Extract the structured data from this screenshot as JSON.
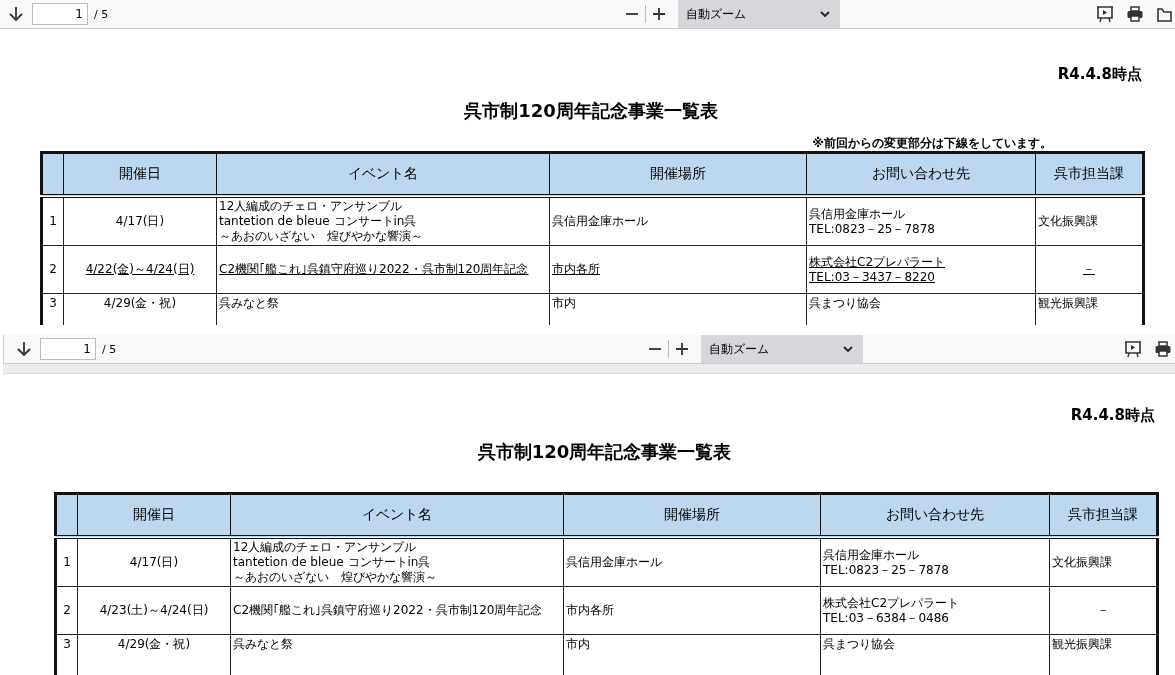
{
  "viewers": [
    {
      "toolbar": {
        "page": "1",
        "page_count": "/ 5",
        "zoom": "自動ズーム",
        "right_tools": [
          {
            "kind": "presentation"
          },
          {
            "kind": "print"
          },
          {
            "kind": "open"
          }
        ]
      },
      "document": {
        "date_label": "R4.4.8時点",
        "title": "呉市制120周年記念事業一覧表",
        "note": "※前回からの変更部分は下線をしています。",
        "table": {
          "columns": [
            "開催日",
            "イベント名",
            "開催場所",
            "お問い合わせ先",
            "呉市担当課"
          ],
          "rows": [
            {
              "no": "1",
              "date": "4/17(日)",
              "event": [
                "12人編成のチェロ・アンサンブル",
                "tantetion de bleue コンサートin呉",
                "～あおのいざない　煌びやかな響演～"
              ],
              "venue": "呉信用金庫ホール",
              "contact": [
                "呉信用金庫ホール",
                "TEL:0823－25－7878"
              ],
              "department": "文化振興課",
              "changed": false
            },
            {
              "no": "2",
              "date": "4/22(金)～4/24(日)",
              "event": [
                "C2機関｢艦これ｣呉鎮守府巡り2022・呉市制120周年記念"
              ],
              "venue": "市内各所",
              "contact": [
                "株式会社C2プレパラート",
                "TEL:03－3437－8220"
              ],
              "department": "－",
              "changed": true
            },
            {
              "no": "3",
              "date": "4/29(金・祝)",
              "event": [
                "呉みなと祭"
              ],
              "venue": "市内",
              "contact": [
                "呉まつり協会"
              ],
              "department": "観光振興課",
              "changed": false
            }
          ]
        }
      }
    },
    {
      "toolbar": {
        "page": "1",
        "page_count": "/ 5",
        "zoom": "自動ズーム",
        "right_tools": [
          {
            "kind": "presentation"
          },
          {
            "kind": "print"
          }
        ]
      },
      "document": {
        "date_label": "R4.4.8時点",
        "title": "呉市制120周年記念事業一覧表",
        "table": {
          "columns": [
            "開催日",
            "イベント名",
            "開催場所",
            "お問い合わせ先",
            "呉市担当課"
          ],
          "rows": [
            {
              "no": "1",
              "date": "4/17(日)",
              "event": [
                "12人編成のチェロ・アンサンブル",
                "tantetion de bleue コンサートin呉",
                "～あおのいざない　煌びやかな響演～"
              ],
              "venue": "呉信用金庫ホール",
              "contact": [
                "呉信用金庫ホール",
                "TEL:0823－25－7878"
              ],
              "department": "文化振興課",
              "changed": false
            },
            {
              "no": "2",
              "date": "4/23(土)～4/24(日)",
              "event": [
                "C2機関｢艦これ｣呉鎮守府巡り2022・呉市制120周年記念"
              ],
              "venue": "市内各所",
              "contact": [
                "株式会社C2プレパラート",
                "TEL:03－6384－0486"
              ],
              "department": "－",
              "changed": false
            },
            {
              "no": "3",
              "date": "4/29(金・祝)",
              "event": [
                "呉みなと祭"
              ],
              "venue": "市内",
              "contact": [
                "呉まつり協会"
              ],
              "department": "観光振興課",
              "changed": false
            }
          ]
        }
      }
    }
  ]
}
